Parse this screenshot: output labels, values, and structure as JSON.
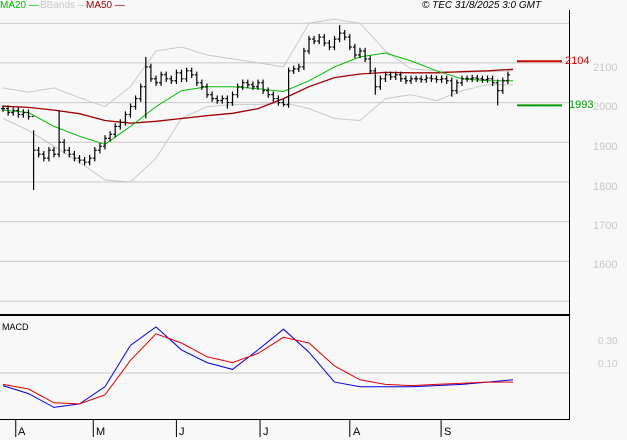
{
  "legend": {
    "ma20": {
      "label": "MA20",
      "color": "#00bb00"
    },
    "bbands": {
      "label": "BBands",
      "color": "#c8c8c8"
    },
    "ma50": {
      "label": "MA50",
      "color": "#a00000"
    }
  },
  "copyright": "© TEC 31/8/2025 3:0 GMT",
  "macd_label": "MACD",
  "markers": {
    "resistance": {
      "label": "2104",
      "value": 2104,
      "color": "#cc0000"
    },
    "support": {
      "label": "1993",
      "value": 1993,
      "color": "#009900"
    }
  },
  "chart_data": {
    "type": "ohlc",
    "price_axis": {
      "ticks": [
        "2100",
        "2000",
        "1900",
        "1800",
        "1700",
        "1600"
      ],
      "tick_values": [
        2100,
        2000,
        1900,
        1800,
        1700,
        1600
      ],
      "gridlines": [
        2200,
        2100,
        2000,
        1900,
        1800,
        1700,
        1600,
        1500
      ]
    },
    "months": [
      "A",
      "M",
      "J",
      "J",
      "A",
      "S"
    ],
    "month_bar_index": [
      2.5,
      17.7,
      34,
      50.4,
      68,
      85.9
    ],
    "close": [
      1985,
      1975,
      1980,
      1970,
      1975,
      1965,
      1880,
      1870,
      1860,
      1880,
      1870,
      1900,
      1880,
      1870,
      1860,
      1855,
      1850,
      1860,
      1880,
      1890,
      1910,
      1920,
      1940,
      1950,
      1970,
      1990,
      2010,
      2040,
      2090,
      2060,
      2050,
      2070,
      2060,
      2055,
      2075,
      2060,
      2080,
      2070,
      2050,
      2040,
      2020,
      2010,
      2005,
      2010,
      2000,
      2020,
      2040,
      2050,
      2045,
      2040,
      2050,
      2030,
      2020,
      2010,
      2000,
      1995,
      2080,
      2085,
      2090,
      2130,
      2160,
      2155,
      2165,
      2150,
      2140,
      2160,
      2175,
      2165,
      2140,
      2120,
      2130,
      2110,
      2080,
      2040,
      2060,
      2070,
      2065,
      2070,
      2060,
      2055,
      2060,
      2060,
      2058,
      2062,
      2060,
      2058,
      2060,
      2055,
      2030,
      2050,
      2060,
      2060,
      2062,
      2060,
      2058,
      2060,
      2050,
      2030,
      2055,
      2070
    ],
    "special_lows": {
      "6": 1780,
      "28": 1960,
      "44": 1985,
      "55": 1990,
      "73": 2020,
      "88": 2015,
      "97": 1993
    },
    "special_highs": {
      "6": 1930,
      "11": 1980,
      "28": 2115,
      "66": 2195
    },
    "sample_every_bars": 5,
    "ma20": [
      1981,
      1975,
      1940,
      1915,
      1895,
      1940,
      1990,
      2030,
      2040,
      2040,
      2035,
      2028,
      2055,
      2090,
      2115,
      2125,
      2105,
      2080,
      2060,
      2055,
      2055
    ],
    "ma50": [
      1991,
      1988,
      1981,
      1972,
      1955,
      1948,
      1953,
      1960,
      1967,
      1973,
      1985,
      2010,
      2040,
      2063,
      2072,
      2076,
      2075,
      2075,
      2078,
      2080,
      2084
    ],
    "bb_upper": [
      2037,
      2026,
      2037,
      2012,
      1990,
      2040,
      2130,
      2140,
      2120,
      2110,
      2100,
      2090,
      2200,
      2210,
      2200,
      2130,
      2085,
      2080,
      2075,
      2078,
      2080
    ],
    "bb_lower": [
      1960,
      1930,
      1890,
      1850,
      1805,
      1800,
      1860,
      1960,
      1990,
      1995,
      1995,
      2000,
      1985,
      1960,
      1955,
      2010,
      2020,
      2005,
      2030,
      2045,
      2045
    ],
    "macd_axis": {
      "ticks": [
        "0.30",
        "0.10"
      ],
      "tick_values": [
        30,
        10
      ]
    },
    "macd": [
      -7,
      -14,
      -26,
      -23,
      -8,
      28,
      44,
      24,
      13,
      7,
      24,
      42,
      22,
      -4,
      -8,
      -8,
      -8,
      -7,
      -6,
      -4,
      -2
    ],
    "macd_signal": [
      -6,
      -10,
      -22,
      -23,
      -15,
      15,
      38,
      30,
      18,
      13,
      21,
      35,
      30,
      10,
      -2,
      -6,
      -7,
      -6,
      -5,
      -4,
      -4
    ],
    "macd_colors": {
      "macd": "#0000dd",
      "signal": "#dd0000"
    }
  }
}
